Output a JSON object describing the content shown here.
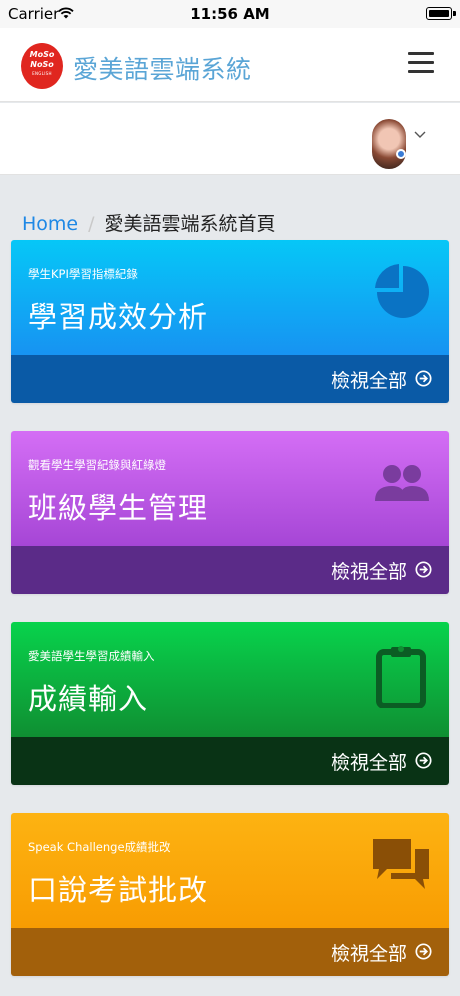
{
  "status_bar": {
    "carrier": "Carrier",
    "time": "11:56 AM"
  },
  "header": {
    "logo": {
      "line1": "MoSo",
      "line2": "NoSo",
      "line3": "ENGLISH"
    },
    "title": "愛美語雲端系統"
  },
  "breadcrumb": {
    "home": "Home",
    "separator": "/",
    "current": "愛美語雲端系統首頁"
  },
  "cards": [
    {
      "subtitle": "學生KPI學習指標紀錄",
      "title": "學習成效分析",
      "action": "檢視全部",
      "icon": "pie-chart-icon",
      "colors": {
        "top": "#06c7f7",
        "bottom": "#0a5aa6",
        "icon": "#0a73c4"
      }
    },
    {
      "subtitle": "觀看學生學習紀錄與紅綠燈",
      "title": "班級學生管理",
      "action": "檢視全部",
      "icon": "users-icon",
      "colors": {
        "top": "#d46ef5",
        "bottom": "#5b2b88",
        "icon": "#7a3c9e"
      }
    },
    {
      "subtitle": "愛美語學生學習成績輸入",
      "title": "成績輸入",
      "action": "檢視全部",
      "icon": "clipboard-icon",
      "colors": {
        "top": "#08d34c",
        "bottom": "#093315",
        "icon": "#0b5d24"
      }
    },
    {
      "subtitle": "Speak Challenge成績批改",
      "title": "口說考試批改",
      "action": "檢視全部",
      "icon": "comments-icon",
      "colors": {
        "top": "#fdb312",
        "bottom": "#a2600b",
        "icon": "#8a4f06"
      }
    }
  ]
}
